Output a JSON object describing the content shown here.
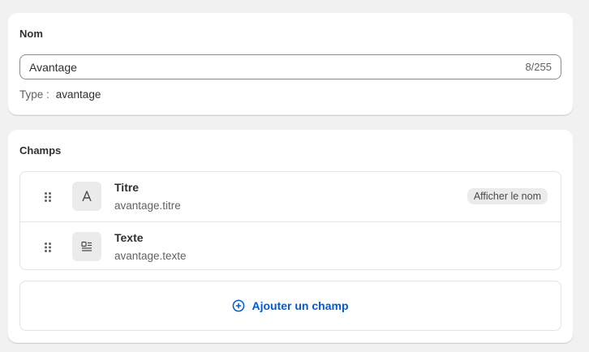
{
  "colors": {
    "background": "#f1f1f1",
    "card": "#ffffff",
    "link": "#005bd3",
    "muted_text": "#616161",
    "badge_bg": "#ebebeb"
  },
  "name_section": {
    "title": "Nom",
    "input_value": "Avantage",
    "counter": "8/255",
    "type_label": "Type :",
    "type_value": "avantage"
  },
  "fields_section": {
    "title": "Champs",
    "fields": [
      {
        "icon": "text-format-icon",
        "title": "Titre",
        "key": "avantage.titre",
        "badge": "Afficher le nom"
      },
      {
        "icon": "text-block-icon",
        "title": "Texte",
        "key": "avantage.texte"
      }
    ],
    "add_button_label": "Ajouter un champ",
    "add_button_icon": "plus-circle-icon"
  }
}
